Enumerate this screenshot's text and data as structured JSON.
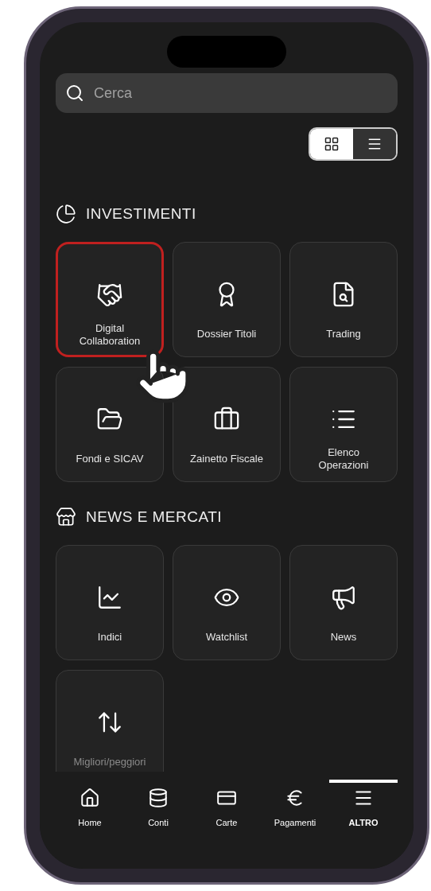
{
  "search": {
    "placeholder": "Cerca"
  },
  "view_toggle": [
    {
      "kind": "grid",
      "selected": true
    },
    {
      "kind": "list",
      "selected": false
    }
  ],
  "sections": [
    {
      "title": "INVESTIMENTI",
      "items": [
        {
          "label": "Digital Collaboration",
          "highlighted": true
        },
        {
          "label": "Dossier Titoli",
          "highlighted": false
        },
        {
          "label": "Trading",
          "highlighted": false
        },
        {
          "label": "Fondi e SICAV",
          "highlighted": false
        },
        {
          "label": "Zainetto Fiscale",
          "highlighted": false
        },
        {
          "label": "Elenco Operazioni",
          "highlighted": false
        }
      ]
    },
    {
      "title": "NEWS E MERCATI",
      "items": [
        {
          "label": "Indici",
          "highlighted": false
        },
        {
          "label": "Watchlist",
          "highlighted": false
        },
        {
          "label": "News",
          "highlighted": false
        },
        {
          "label": "Migliori/peggiori",
          "highlighted": false
        }
      ]
    }
  ],
  "bottom_nav": [
    {
      "label": "Home",
      "selected": false
    },
    {
      "label": "Conti",
      "selected": false
    },
    {
      "label": "Carte",
      "selected": false
    },
    {
      "label": "Pagamenti",
      "selected": false
    },
    {
      "label": "ALTRO",
      "selected": true
    }
  ]
}
